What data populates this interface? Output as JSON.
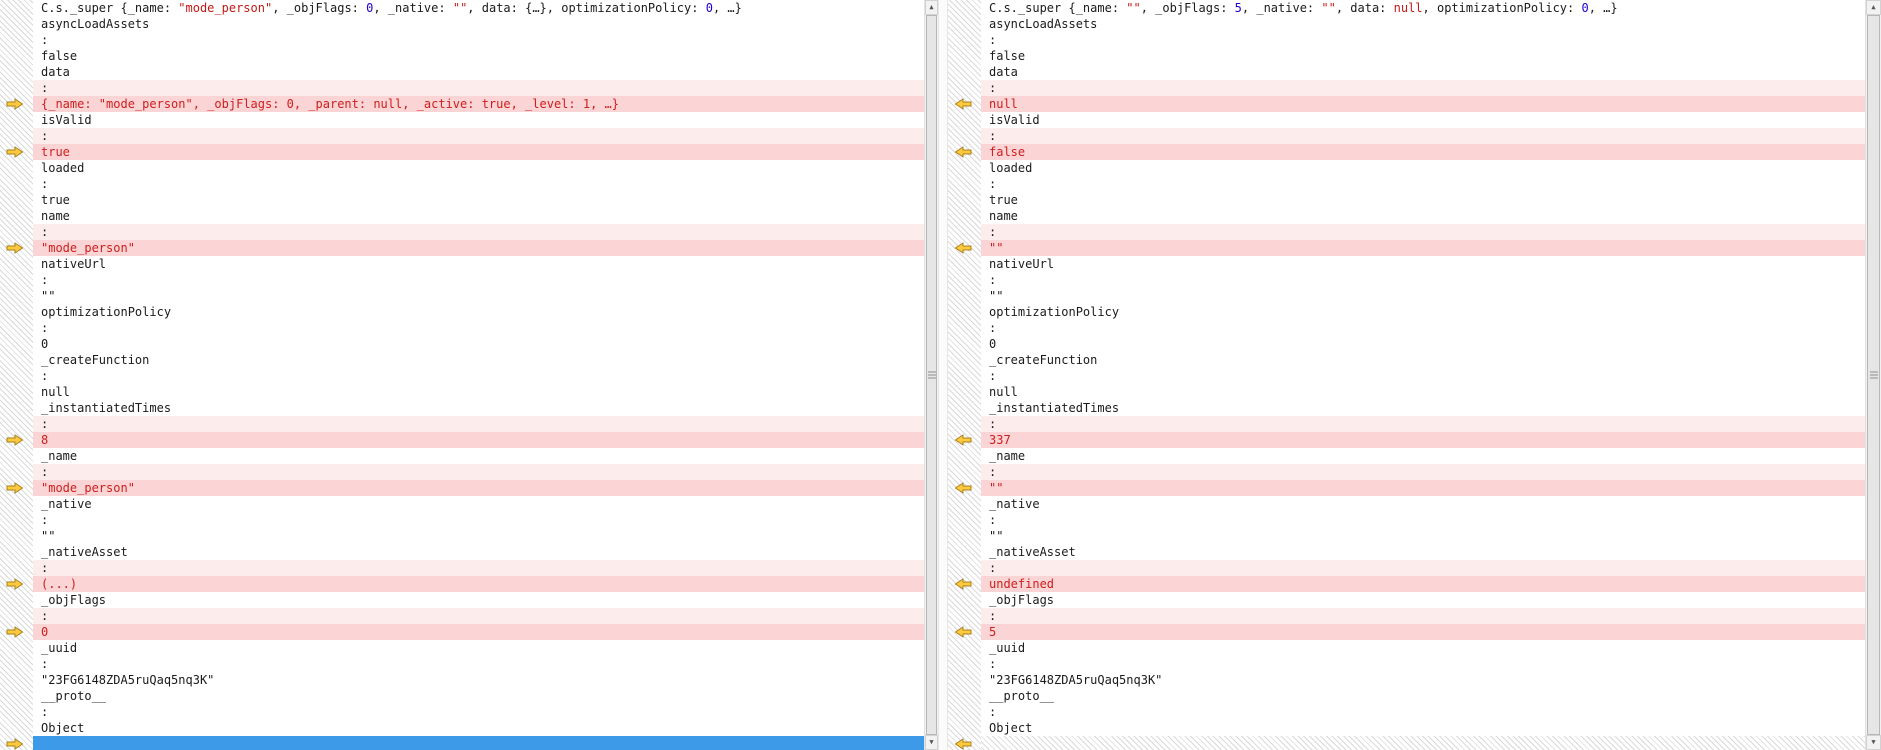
{
  "colors": {
    "changed_row_background": "#fbd5d5",
    "changed_colon_background": "#fdecec",
    "changed_text": "#cf1d1d",
    "string_literal": "#c41a16",
    "number_literal": "#1c00cf",
    "selected_row_background": "#3d9ae8",
    "diff_arrow_fill": "#ffc93e",
    "diff_arrow_outline": "#a5821c"
  },
  "scrollbar": {
    "up_glyph": "▲",
    "down_glyph": "▼"
  },
  "panels": {
    "left": {
      "arrow_direction": "right",
      "rows": [
        {
          "type": "header",
          "tokens": [
            {
              "c": "t",
              "v": "C.s._super {_name: "
            },
            {
              "c": "s",
              "v": "\"mode_person\""
            },
            {
              "c": "t",
              "v": ", _objFlags: "
            },
            {
              "c": "n",
              "v": "0"
            },
            {
              "c": "t",
              "v": ", _native: "
            },
            {
              "c": "s",
              "v": "\"\""
            },
            {
              "c": "t",
              "v": ", data: {…}, optimizationPolicy: "
            },
            {
              "c": "n",
              "v": "0"
            },
            {
              "c": "t",
              "v": ", …}"
            }
          ]
        },
        {
          "type": "plain",
          "text": "asyncLoadAssets"
        },
        {
          "type": "plain",
          "text": ":"
        },
        {
          "type": "plain",
          "text": "false"
        },
        {
          "type": "plain",
          "text": "data"
        },
        {
          "type": "colon_hl",
          "text": ":"
        },
        {
          "type": "changed",
          "arrow": true,
          "text": "{_name: \"mode_person\", _objFlags: 0, _parent: null, _active: true, _level: 1, …}"
        },
        {
          "type": "plain",
          "text": "isValid"
        },
        {
          "type": "colon_hl",
          "text": ":"
        },
        {
          "type": "changed",
          "arrow": true,
          "text": "true"
        },
        {
          "type": "plain",
          "text": "loaded"
        },
        {
          "type": "plain",
          "text": ":"
        },
        {
          "type": "plain",
          "text": "true"
        },
        {
          "type": "plain",
          "text": "name"
        },
        {
          "type": "colon_hl",
          "text": ":"
        },
        {
          "type": "changed",
          "arrow": true,
          "text": "\"mode_person\""
        },
        {
          "type": "plain",
          "text": "nativeUrl"
        },
        {
          "type": "plain",
          "text": ":"
        },
        {
          "type": "plain",
          "text": "\"\""
        },
        {
          "type": "plain",
          "text": "optimizationPolicy"
        },
        {
          "type": "plain",
          "text": ":"
        },
        {
          "type": "plain",
          "text": "0"
        },
        {
          "type": "plain",
          "text": "_createFunction"
        },
        {
          "type": "plain",
          "text": ":"
        },
        {
          "type": "plain",
          "text": "null"
        },
        {
          "type": "plain",
          "text": "_instantiatedTimes"
        },
        {
          "type": "colon_hl",
          "text": ":"
        },
        {
          "type": "changed",
          "arrow": true,
          "text": "8"
        },
        {
          "type": "plain",
          "text": "_name"
        },
        {
          "type": "colon_hl",
          "text": ":"
        },
        {
          "type": "changed",
          "arrow": true,
          "text": "\"mode_person\""
        },
        {
          "type": "plain",
          "text": "_native"
        },
        {
          "type": "plain",
          "text": ":"
        },
        {
          "type": "plain",
          "text": "\"\""
        },
        {
          "type": "plain",
          "text": "_nativeAsset"
        },
        {
          "type": "colon_hl",
          "text": ":"
        },
        {
          "type": "changed",
          "arrow": true,
          "text": "(...)"
        },
        {
          "type": "plain",
          "text": "_objFlags"
        },
        {
          "type": "colon_hl",
          "text": ":"
        },
        {
          "type": "changed",
          "arrow": true,
          "text": "0"
        },
        {
          "type": "plain",
          "text": "_uuid"
        },
        {
          "type": "plain",
          "text": ":"
        },
        {
          "type": "plain",
          "text": "\"23FG6148ZDA5ruQaq5nq3K\""
        },
        {
          "type": "plain",
          "text": "__proto__"
        },
        {
          "type": "plain",
          "text": ":"
        },
        {
          "type": "plain",
          "text": "Object"
        },
        {
          "type": "selected",
          "arrow": true,
          "text": ""
        }
      ]
    },
    "right": {
      "arrow_direction": "left",
      "rows": [
        {
          "type": "header",
          "tokens": [
            {
              "c": "t",
              "v": "C.s._super {_name: "
            },
            {
              "c": "s",
              "v": "\"\""
            },
            {
              "c": "t",
              "v": ", _objFlags: "
            },
            {
              "c": "n",
              "v": "5"
            },
            {
              "c": "t",
              "v": ", _native: "
            },
            {
              "c": "s",
              "v": "\"\""
            },
            {
              "c": "t",
              "v": ", data: "
            },
            {
              "c": "k",
              "v": "null"
            },
            {
              "c": "t",
              "v": ", optimizationPolicy: "
            },
            {
              "c": "n",
              "v": "0"
            },
            {
              "c": "t",
              "v": ", …}"
            }
          ]
        },
        {
          "type": "plain",
          "text": "asyncLoadAssets"
        },
        {
          "type": "plain",
          "text": ":"
        },
        {
          "type": "plain",
          "text": "false"
        },
        {
          "type": "plain",
          "text": "data"
        },
        {
          "type": "colon_hl",
          "text": ":"
        },
        {
          "type": "changed",
          "arrow": true,
          "text": "null"
        },
        {
          "type": "plain",
          "text": "isValid"
        },
        {
          "type": "colon_hl",
          "text": ":"
        },
        {
          "type": "changed",
          "arrow": true,
          "text": "false"
        },
        {
          "type": "plain",
          "text": "loaded"
        },
        {
          "type": "plain",
          "text": ":"
        },
        {
          "type": "plain",
          "text": "true"
        },
        {
          "type": "plain",
          "text": "name"
        },
        {
          "type": "colon_hl",
          "text": ":"
        },
        {
          "type": "changed",
          "arrow": true,
          "text": "\"\""
        },
        {
          "type": "plain",
          "text": "nativeUrl"
        },
        {
          "type": "plain",
          "text": ":"
        },
        {
          "type": "plain",
          "text": "\"\""
        },
        {
          "type": "plain",
          "text": "optimizationPolicy"
        },
        {
          "type": "plain",
          "text": ":"
        },
        {
          "type": "plain",
          "text": "0"
        },
        {
          "type": "plain",
          "text": "_createFunction"
        },
        {
          "type": "plain",
          "text": ":"
        },
        {
          "type": "plain",
          "text": "null"
        },
        {
          "type": "plain",
          "text": "_instantiatedTimes"
        },
        {
          "type": "colon_hl",
          "text": ":"
        },
        {
          "type": "changed",
          "arrow": true,
          "text": "337"
        },
        {
          "type": "plain",
          "text": "_name"
        },
        {
          "type": "colon_hl",
          "text": ":"
        },
        {
          "type": "changed",
          "arrow": true,
          "text": "\"\""
        },
        {
          "type": "plain",
          "text": "_native"
        },
        {
          "type": "plain",
          "text": ":"
        },
        {
          "type": "plain",
          "text": "\"\""
        },
        {
          "type": "plain",
          "text": "_nativeAsset"
        },
        {
          "type": "colon_hl",
          "text": ":"
        },
        {
          "type": "changed",
          "arrow": true,
          "text": "undefined"
        },
        {
          "type": "plain",
          "text": "_objFlags"
        },
        {
          "type": "colon_hl",
          "text": ":"
        },
        {
          "type": "changed",
          "arrow": true,
          "text": "5"
        },
        {
          "type": "plain",
          "text": "_uuid"
        },
        {
          "type": "plain",
          "text": ":"
        },
        {
          "type": "plain",
          "text": "\"23FG6148ZDA5ruQaq5nq3K\""
        },
        {
          "type": "plain",
          "text": "__proto__"
        },
        {
          "type": "plain",
          "text": ":"
        },
        {
          "type": "plain",
          "text": "Object"
        },
        {
          "type": "missing",
          "arrow": true,
          "text": ""
        }
      ]
    }
  }
}
